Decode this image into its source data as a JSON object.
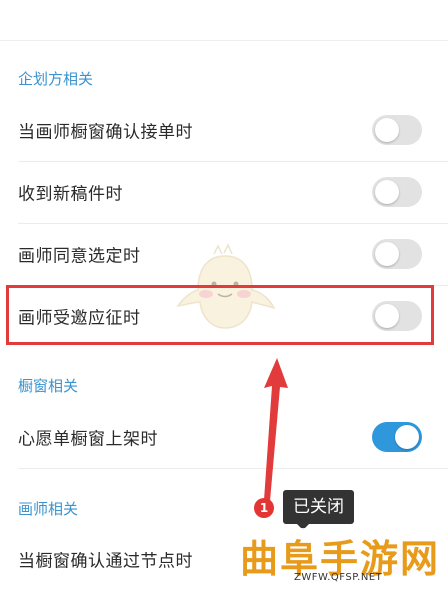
{
  "top_partial": {
    "label": "一  一  一  一"
  },
  "sections": [
    {
      "title": "企划方相关",
      "items": [
        {
          "label": "当画师橱窗确认接单时",
          "on": false
        },
        {
          "label": "收到新稿件时",
          "on": false
        },
        {
          "label": "画师同意选定时",
          "on": false
        },
        {
          "label": "画师受邀应征时",
          "on": false
        }
      ]
    },
    {
      "title": "橱窗相关",
      "items": [
        {
          "label": "心愿单橱窗上架时",
          "on": true
        }
      ]
    },
    {
      "title": "画师相关",
      "items": [
        {
          "label": "当橱窗确认通过节点时",
          "on": false
        }
      ]
    }
  ],
  "annotation": {
    "badge": "1",
    "tooltip": "已关闭"
  },
  "watermark": {
    "text": "曲阜手游网",
    "url": "ZWFW.QFSP.NET"
  },
  "colors": {
    "accent": "#2f98dd",
    "section": "#3a93cf",
    "highlight": "#e23b3b",
    "arrow": "#e23b3b"
  }
}
